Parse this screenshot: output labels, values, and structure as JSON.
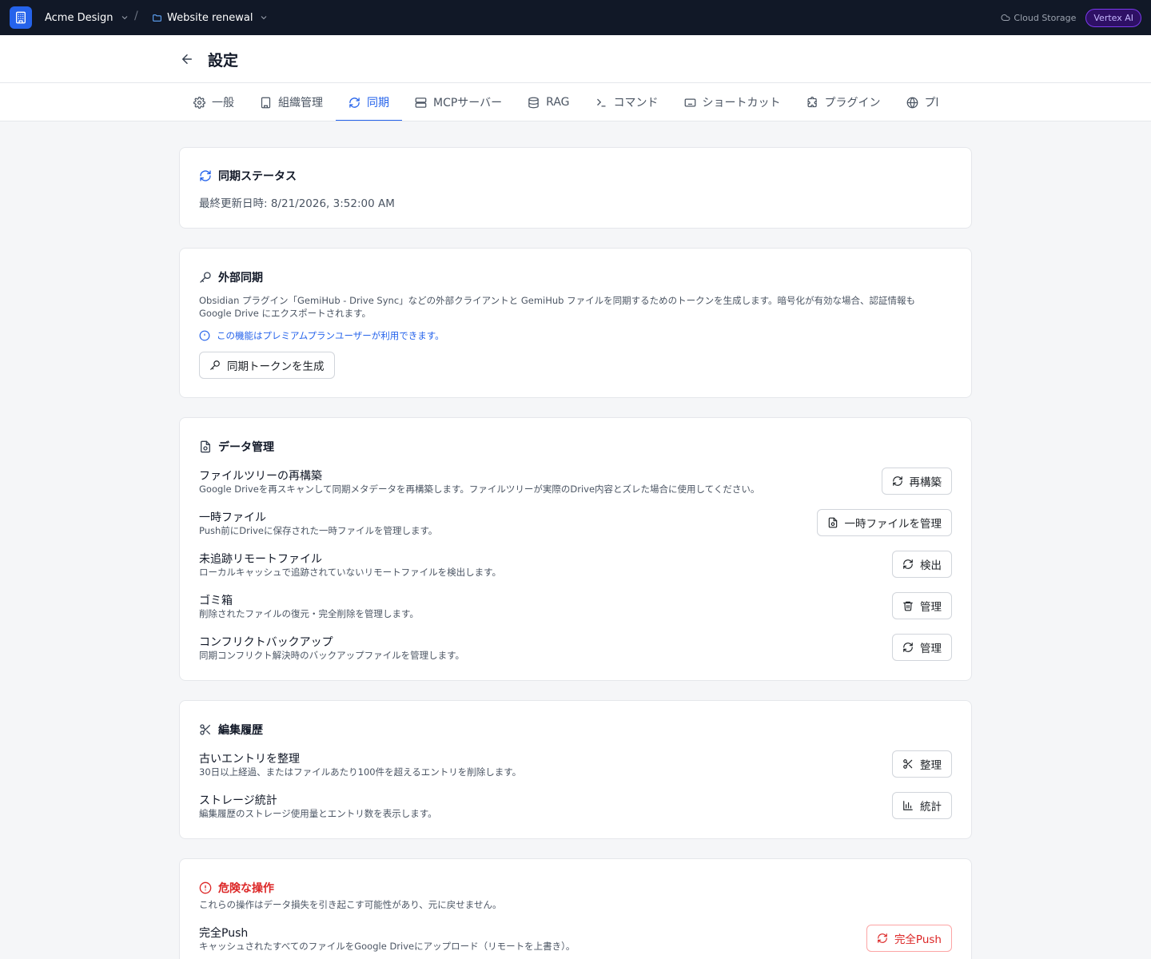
{
  "topbar": {
    "workspace": "Acme Design",
    "project": "Website renewal",
    "separator": "/",
    "storage_label": "Cloud Storage",
    "model_badge": "Vertex AI"
  },
  "header": {
    "title": "設定"
  },
  "tabs": [
    {
      "label": "一般",
      "icon": "gear-icon"
    },
    {
      "label": "組織管理",
      "icon": "building-icon"
    },
    {
      "label": "同期",
      "icon": "sync-icon",
      "active": true
    },
    {
      "label": "MCPサーバー",
      "icon": "server-icon"
    },
    {
      "label": "RAG",
      "icon": "database-icon"
    },
    {
      "label": "コマンド",
      "icon": "terminal-icon"
    },
    {
      "label": "ショートカット",
      "icon": "keyboard-icon"
    },
    {
      "label": "プラグイン",
      "icon": "puzzle-icon"
    },
    {
      "label": "プl",
      "icon": "globe-icon"
    }
  ],
  "sync_status": {
    "title": "同期ステータス",
    "last_updated": "最終更新日時: 8/21/2026, 3:52:00 AM"
  },
  "external_sync": {
    "title": "外部同期",
    "description_line1": "Obsidian プラグイン「GemiHub - Drive Sync」などの外部クライアントと GemiHub ファイルを同期するためのトークンを生成します。暗号化が有効な場合、認証情報も",
    "description_line2": "Google Drive にエクスポートされます。",
    "premium_note": "この機能はプレミアムプランユーザーが利用できます。",
    "button": "同期トークンを生成"
  },
  "data_management": {
    "title": "データ管理",
    "rows": [
      {
        "title": "ファイルツリーの再構築",
        "desc": "Google Driveを再スキャンして同期メタデータを再構築します。ファイルツリーが実際のDrive内容とズレた場合に使用してください。",
        "button": "再構築",
        "icon": "refresh-icon"
      },
      {
        "title": "一時ファイル",
        "desc": "Push前にDriveに保存された一時ファイルを管理します。",
        "button": "一時ファイルを管理",
        "icon": "file-sync-icon"
      },
      {
        "title": "未追跡リモートファイル",
        "desc": "ローカルキャッシュで追跡されていないリモートファイルを検出します。",
        "button": "検出",
        "icon": "refresh-icon"
      },
      {
        "title": "ゴミ箱",
        "desc": "削除されたファイルの復元・完全削除を管理します。",
        "button": "管理",
        "icon": "trash-icon"
      },
      {
        "title": "コンフリクトバックアップ",
        "desc": "同期コンフリクト解決時のバックアップファイルを管理します。",
        "button": "管理",
        "icon": "refresh-icon"
      }
    ]
  },
  "edit_history": {
    "title": "編集履歴",
    "rows": [
      {
        "title": "古いエントリを整理",
        "desc": "30日以上経過、またはファイルあたり100件を超えるエントリを削除します。",
        "button": "整理",
        "icon": "scissors-icon"
      },
      {
        "title": "ストレージ統計",
        "desc": "編集履歴のストレージ使用量とエントリ数を表示します。",
        "button": "統計",
        "icon": "bar-chart-icon"
      }
    ]
  },
  "danger_zone": {
    "title": "危険な操作",
    "subtitle": "これらの操作はデータ損失を引き起こす可能性があり、元に戻せません。",
    "row": {
      "title": "完全Push",
      "desc": "キャッシュされたすべてのファイルをGoogle Driveにアップロード（リモートを上書き）。",
      "button": "完全Push",
      "icon": "refresh-icon"
    }
  },
  "colors": {
    "accent": "#2563eb",
    "danger": "#dc2626",
    "topbar_bg": "#111827"
  }
}
